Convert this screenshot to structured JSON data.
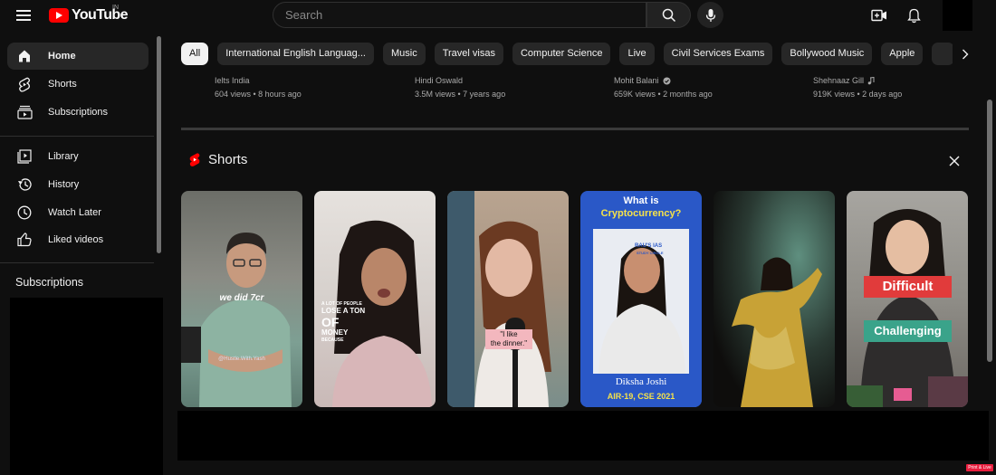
{
  "header": {
    "logo_text": "YouTube",
    "region": "IN",
    "search_placeholder": "Search"
  },
  "sidebar": {
    "items": [
      {
        "label": "Home",
        "icon": "home-icon",
        "active": true
      },
      {
        "label": "Shorts",
        "icon": "shorts-icon"
      },
      {
        "label": "Subscriptions",
        "icon": "subscriptions-icon"
      },
      {
        "label": "Library",
        "icon": "library-icon"
      },
      {
        "label": "History",
        "icon": "history-icon"
      },
      {
        "label": "Watch Later",
        "icon": "clock-icon"
      },
      {
        "label": "Liked videos",
        "icon": "thumbs-up-icon"
      }
    ],
    "subscriptions_heading": "Subscriptions"
  },
  "chips": [
    {
      "label": "All",
      "active": true
    },
    {
      "label": "International English Languag..."
    },
    {
      "label": "Music"
    },
    {
      "label": "Travel visas"
    },
    {
      "label": "Computer Science"
    },
    {
      "label": "Live"
    },
    {
      "label": "Civil Services Exams"
    },
    {
      "label": "Bollywood Music"
    },
    {
      "label": "Apple"
    }
  ],
  "prev_videos": [
    {
      "channel": "Ielts India",
      "meta": "604 views • 8 hours ago"
    },
    {
      "channel": "Hindi Oswald",
      "meta": "3.5M views • 7 years ago"
    },
    {
      "channel": "Mohit Balani",
      "meta": "659K views • 2 months ago",
      "verified": true
    },
    {
      "channel": "Shehnaaz Gill",
      "meta": "919K views • 2 days ago",
      "music_badge": true
    }
  ],
  "shorts": {
    "title": "Shorts",
    "items": [
      {
        "caption": "we did 7cr",
        "sub": "@Hustle.With.Yash"
      },
      {
        "caption_small": "A LOT OF PEOPLE",
        "caption_mid": "LOSE A TON",
        "caption_big": "OF",
        "caption_mid2": "MONEY",
        "caption_small2": "BECAUSE"
      },
      {
        "caption": "\"I like\nthe dinner.\""
      },
      {
        "caption_top1": "What is",
        "caption_top2": "Cryptocurrency?",
        "brand": "RAU'S IAS",
        "brand2": "STUDY CIRCLE",
        "name": "Diksha Joshi",
        "rank": "AIR-19, CSE 2021"
      },
      {},
      {
        "caption1": "Difficult",
        "caption2": "Challenging"
      }
    ]
  },
  "colors": {
    "accent": "#ff0000",
    "background": "#0f0f0f",
    "chip": "#272727"
  }
}
